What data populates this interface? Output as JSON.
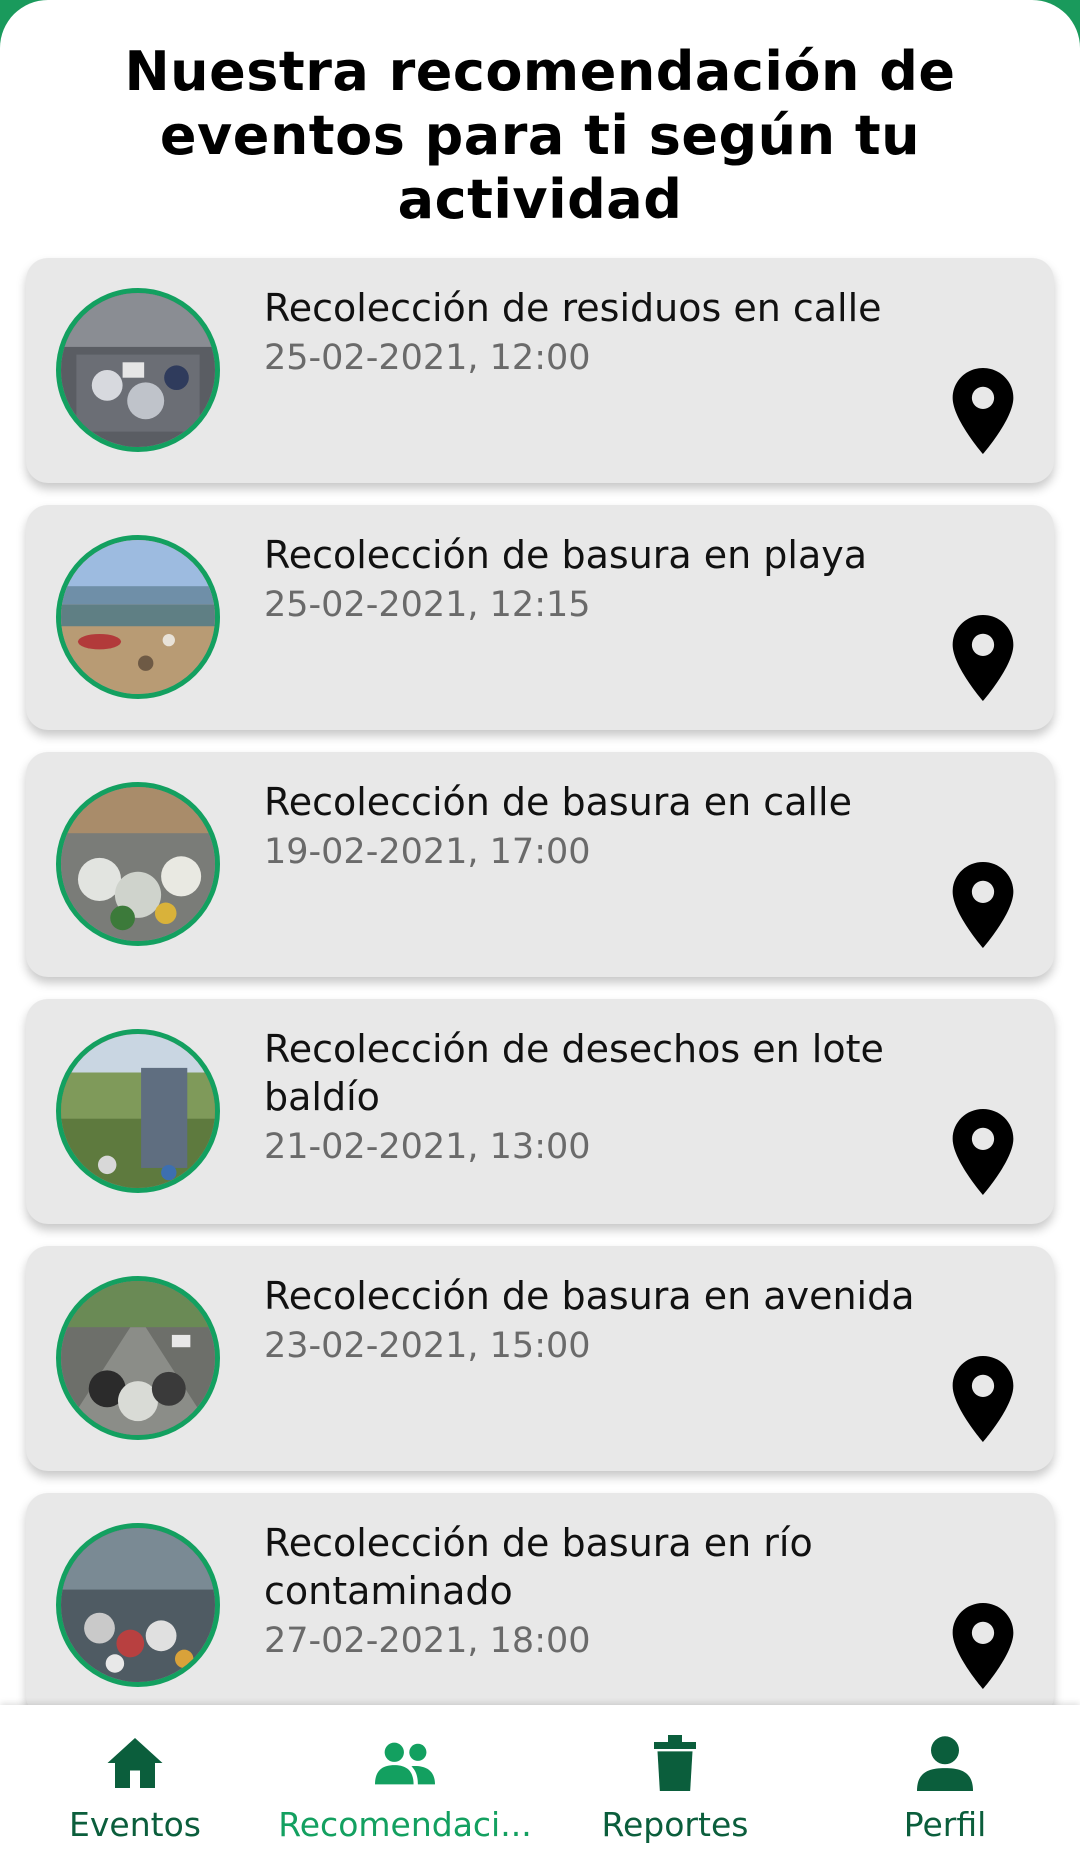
{
  "page": {
    "title": "Nuestra recomendación de eventos para ti según tu actividad"
  },
  "events": [
    {
      "title": "Recolección de residuos en calle",
      "date": "25-02-2021, 12:00",
      "image": "street-garbage-image"
    },
    {
      "title": "Recolección de basura en playa",
      "date": "25-02-2021, 12:15",
      "image": "beach-garbage-image"
    },
    {
      "title": "Recolección de basura en calle",
      "date": "19-02-2021, 17:00",
      "image": "street-garbage-bags-image"
    },
    {
      "title": "Recolección de desechos en lote baldío",
      "date": "21-02-2021, 13:00",
      "image": "vacant-lot-trash-image"
    },
    {
      "title": "Recolección de basura en avenida",
      "date": "23-02-2021, 15:00",
      "image": "avenue-garbage-image"
    },
    {
      "title": "Recolección de basura en río contaminado",
      "date": "27-02-2021, 18:00",
      "image": "polluted-river-image"
    }
  ],
  "nav": {
    "items": [
      {
        "label": "Eventos",
        "icon": "home-icon"
      },
      {
        "label": "Recomendaci...",
        "icon": "people-icon",
        "active": true
      },
      {
        "label": "Reportes",
        "icon": "trash-icon"
      },
      {
        "label": "Perfil",
        "icon": "person-icon"
      }
    ]
  },
  "colors": {
    "accent": "#13a060",
    "nav_text": "#0b5e3c",
    "card_bg": "#e8e8e8",
    "date_text": "#6a6a6a"
  }
}
